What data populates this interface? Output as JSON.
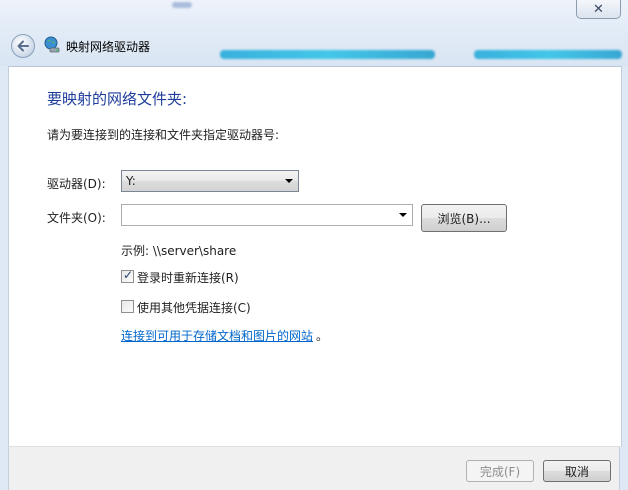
{
  "window": {
    "title": "映射网络驱动器",
    "close_glyph": "✕"
  },
  "content": {
    "heading": "要映射的网络文件夹:",
    "instruction": "请为要连接到的连接和文件夹指定驱动器号:",
    "drive_label": "驱动器(D):",
    "drive_value": "Y:",
    "folder_label": "文件夹(O):",
    "folder_value": "",
    "browse_label": "浏览(B)...",
    "example": "示例: \\\\server\\share",
    "reconnect_label": "登录时重新连接(R)",
    "reconnect_checked": true,
    "credentials_label": "使用其他凭据连接(C)",
    "credentials_checked": false,
    "link_text": "连接到可用于存储文档和图片的网站",
    "link_suffix": "。"
  },
  "footer": {
    "finish_label": "完成(F)",
    "cancel_label": "取消"
  },
  "icons": {
    "back": "back-arrow-icon",
    "network": "network-drive-icon",
    "check": "✓"
  },
  "colors": {
    "heading": "#1f3d9b",
    "link": "#0066cc",
    "aero": "#dfe9f5"
  }
}
